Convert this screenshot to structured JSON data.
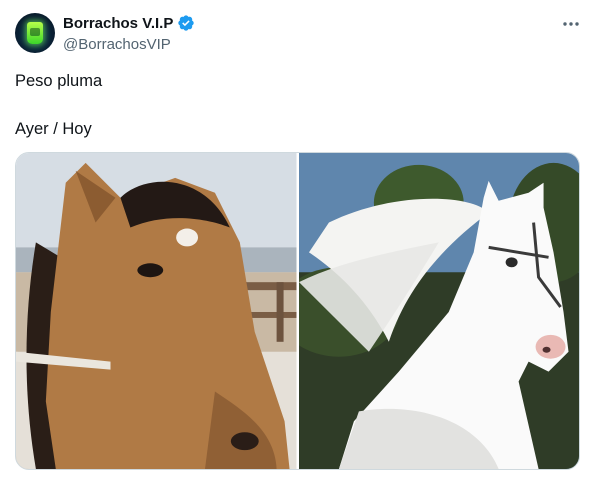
{
  "tweet": {
    "author": {
      "display_name": "Borrachos V.I.P",
      "handle": "@BorrachosVIP",
      "verified": true,
      "verified_color": "#1d9bf0",
      "avatar_icon": "green-cup-avatar"
    },
    "text_lines": [
      "Peso pluma",
      "Ayer / Hoy"
    ],
    "more_icon": "more-options-icon",
    "media": [
      {
        "description_icon": "brown-horse-photo"
      },
      {
        "description_icon": "white-horse-photo"
      }
    ]
  },
  "colors": {
    "text_primary": "#0f1419",
    "text_secondary": "#536471",
    "border": "#cfd9de"
  }
}
